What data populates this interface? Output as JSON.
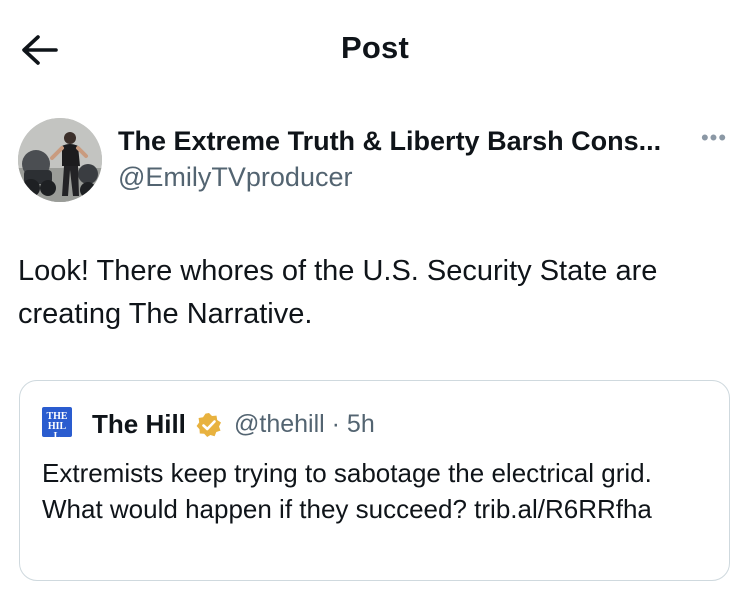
{
  "header": {
    "title": "Post",
    "back_icon": "back-arrow-icon"
  },
  "author": {
    "display_name": "The Extreme Truth & Liberty Barsh Cons...",
    "handle": "@EmilyTVproducer",
    "avatar_icon": "profile-photo",
    "more_icon": "more-options-icon"
  },
  "post": {
    "text": "Look! There whores of the U.S. Security State are creating The Narrative."
  },
  "quoted_post": {
    "logo_text": "THE HILL",
    "name": "The Hill",
    "verified_icon": "verified-badge-icon",
    "handle_time": "@thehill · 5h",
    "text": "Extremists keep trying to sabotage the electrical grid. What would happen if they succeed? trib.al/R6RRfha",
    "colors": {
      "logo": "#2a5ccf",
      "verified": "#e8b23f"
    }
  }
}
